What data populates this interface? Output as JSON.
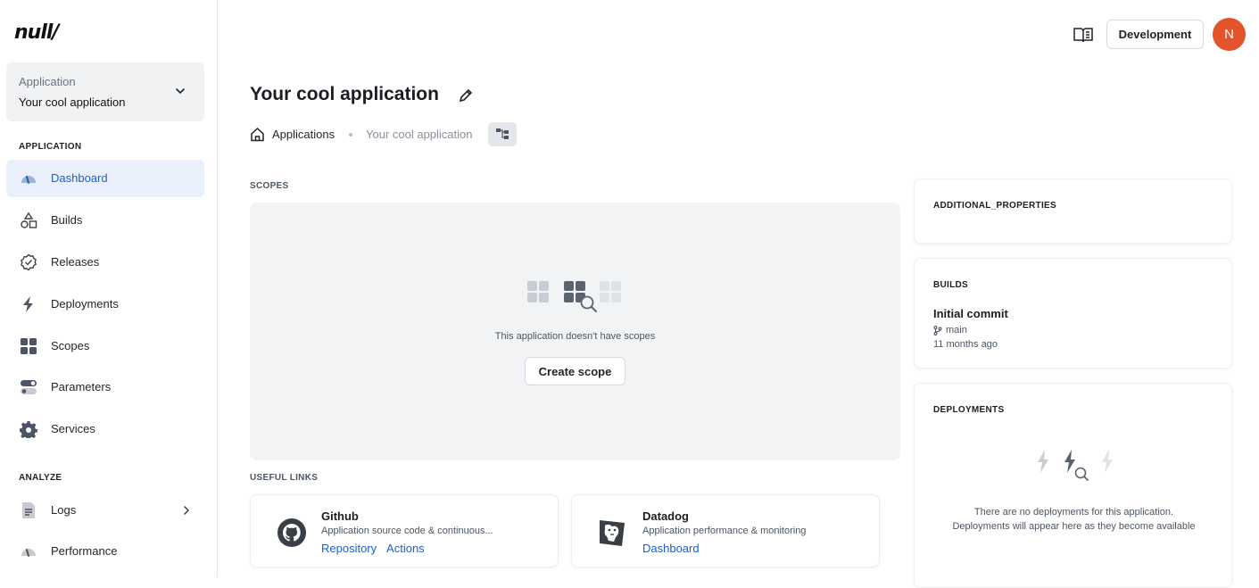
{
  "logo": {
    "text": "null/"
  },
  "app_selector": {
    "label": "Application",
    "value": "Your cool application"
  },
  "sidebar": {
    "section_application": "APPLICATION",
    "items": [
      {
        "label": "Dashboard",
        "icon": "dashboard-gauge-icon",
        "active": true
      },
      {
        "label": "Builds",
        "icon": "shapes-icon"
      },
      {
        "label": "Releases",
        "icon": "badge-check-icon"
      },
      {
        "label": "Deployments",
        "icon": "lightning-icon"
      },
      {
        "label": "Scopes",
        "icon": "grid-icon"
      },
      {
        "label": "Parameters",
        "icon": "toggles-icon"
      },
      {
        "label": "Services",
        "icon": "gear-icon"
      }
    ],
    "section_analyze": "ANALYZE",
    "analyze_items": [
      {
        "label": "Logs",
        "icon": "document-icon"
      },
      {
        "label": "Performance",
        "icon": "gauge-icon"
      }
    ]
  },
  "topbar": {
    "environment": "Development",
    "avatar_initial": "N",
    "accent": "#e4542a"
  },
  "page": {
    "title": "Your cool application"
  },
  "breadcrumb": {
    "root": "Applications",
    "current": "Your cool application"
  },
  "scopes": {
    "header": "SCOPES",
    "empty_text": "This application doesn't have scopes",
    "create_label": "Create scope"
  },
  "useful_links": {
    "header": "USEFUL LINKS",
    "cards": [
      {
        "title": "Github",
        "description": "Application source code & continuous...",
        "links": [
          "Repository",
          "Actions"
        ]
      },
      {
        "title": "Datadog",
        "description": "Application performance & monitoring",
        "links": [
          "Dashboard"
        ]
      }
    ]
  },
  "right_panels": {
    "additional_properties": "ADDITIONAL_PROPERTIES",
    "builds": {
      "header": "BUILDS",
      "title": "Initial commit",
      "branch": "main",
      "time": "11 months ago"
    },
    "deployments": {
      "header": "DEPLOYMENTS",
      "empty_text": "There are no deployments for this application. Deployments will appear here as they become available"
    }
  }
}
